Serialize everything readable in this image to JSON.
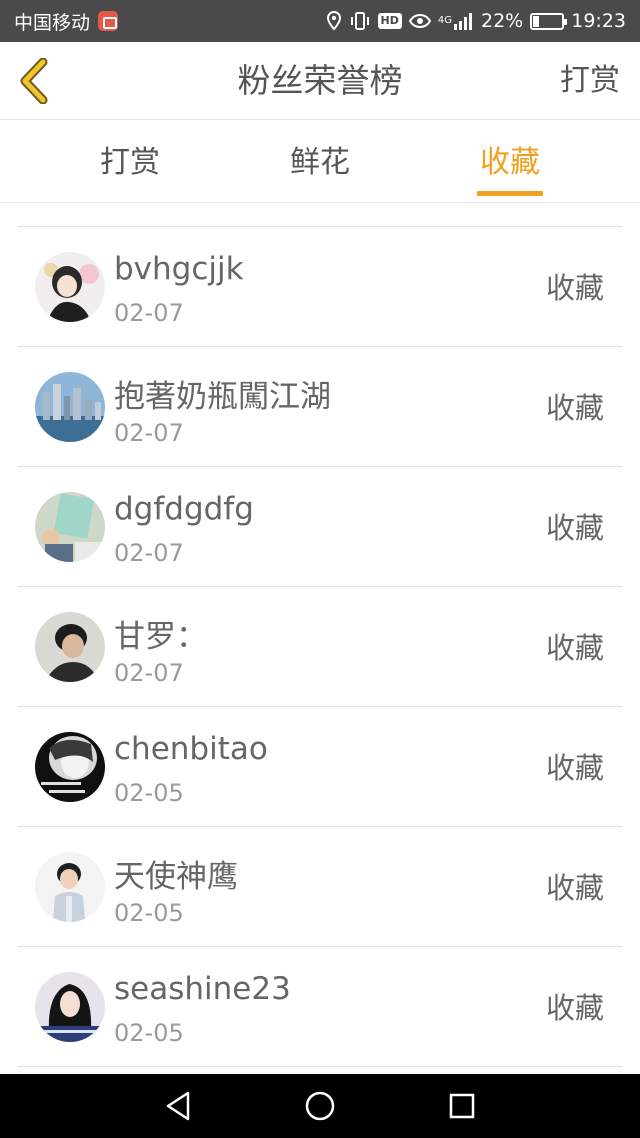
{
  "status_bar": {
    "carrier": "中国移动",
    "hd_label": "HD",
    "net_label": "4G",
    "battery": "22%",
    "battery_level": 0.22,
    "time": "19:23"
  },
  "header": {
    "title": "粉丝荣誉榜",
    "action": "打赏",
    "back_icon": "chevron-left-icon"
  },
  "tabs": [
    {
      "label": "打赏",
      "active": false
    },
    {
      "label": "鲜花",
      "active": false
    },
    {
      "label": "收藏",
      "active": true
    }
  ],
  "colors": {
    "accent": "#f0a020",
    "status_bar": "#4a4a4a",
    "nav_bar": "#000000"
  },
  "list": [
    {
      "name": "bvhgcjjk",
      "date": "02-07",
      "action": "收藏"
    },
    {
      "name": "抱著奶瓶闖江湖",
      "date": "02-07",
      "action": "收藏"
    },
    {
      "name": "dgfdgdfg",
      "date": "02-07",
      "action": "收藏"
    },
    {
      "name": "甘罗：",
      "date": "02-07",
      "action": "收藏"
    },
    {
      "name": "chenbitao",
      "date": "02-05",
      "action": "收藏"
    },
    {
      "name": "天使神鹰",
      "date": "02-05",
      "action": "收藏"
    },
    {
      "name": "seashine23",
      "date": "02-05",
      "action": "收藏"
    }
  ],
  "nav_bar": {
    "icons": [
      "back-triangle-icon",
      "home-circle-icon",
      "recents-square-icon"
    ]
  }
}
